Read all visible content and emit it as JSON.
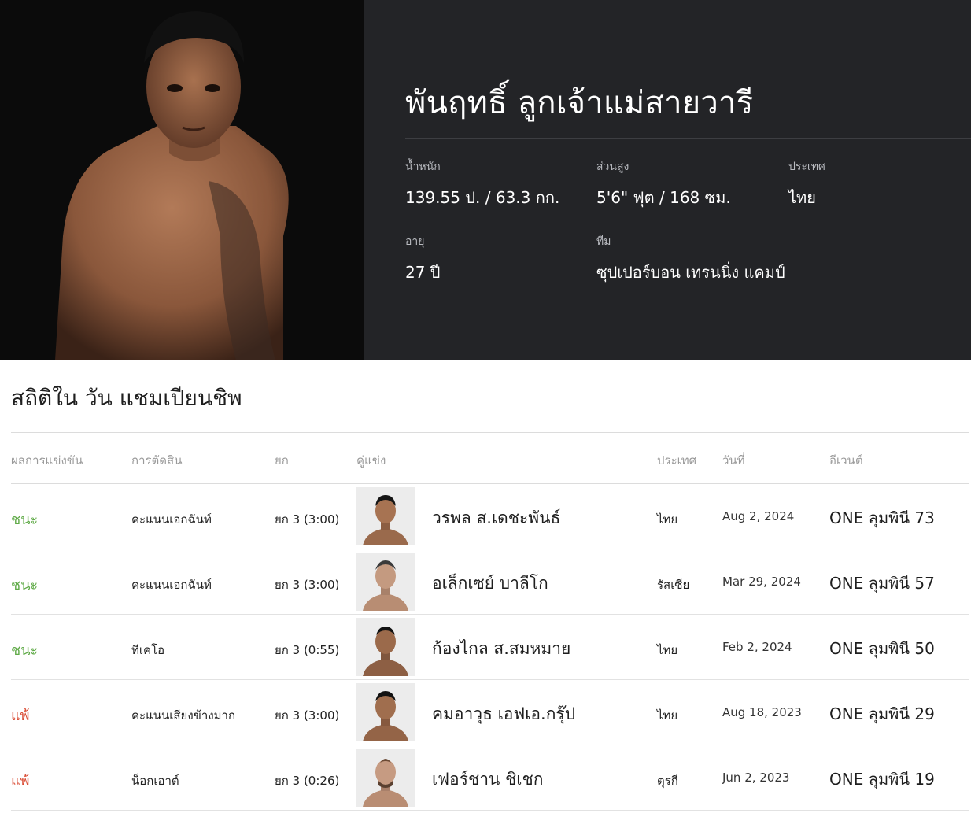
{
  "fighter": {
    "name": "พันฤทธิ์ ลูกเจ้าแม่สายวารี",
    "stats": {
      "weight_label": "น้ำหนัก",
      "weight_value": "139.55 ป. / 63.3 กก.",
      "height_label": "ส่วนสูง",
      "height_value": "5'6\" ฟุต / 168 ซม.",
      "country_label": "ประเทศ",
      "country_value": "ไทย",
      "age_label": "อายุ",
      "age_value": "27 ปี",
      "team_label": "ทีม",
      "team_value": "ซุปเปอร์บอน เทรนนิ่ง แคมป์"
    }
  },
  "record": {
    "title": "สถิติใน วัน แชมเปียนชิพ",
    "headers": {
      "result": "ผลการแข่งขัน",
      "method": "การตัดสิน",
      "round": "ยก",
      "opponent": "คู่แข่ง",
      "country": "ประเทศ",
      "date": "วันที่",
      "event": "อีเวนต์"
    },
    "rows": [
      {
        "result": "ชนะ",
        "method": "คะแนนเอกฉันท์",
        "round": "ยก 3 (3:00)",
        "opponent": "วรพล ส.เดชะพันธ์",
        "country": "ไทย",
        "date": "Aug 2, 2024",
        "event": "ONE ลุมพินี 73"
      },
      {
        "result": "ชนะ",
        "method": "คะแนนเอกฉันท์",
        "round": "ยก 3 (3:00)",
        "opponent": "อเล็กเซย์ บาลีโก",
        "country": "รัสเซีย",
        "date": "Mar 29, 2024",
        "event": "ONE ลุมพินี 57"
      },
      {
        "result": "ชนะ",
        "method": "ทีเคโอ",
        "round": "ยก 3 (0:55)",
        "opponent": "ก้องไกล ส.สมหมาย",
        "country": "ไทย",
        "date": "Feb 2, 2024",
        "event": "ONE ลุมพินี 50"
      },
      {
        "result": "แพ้",
        "method": "คะแนนเสียงข้างมาก",
        "round": "ยก 3 (3:00)",
        "opponent": "คมอาวุธ เอฟเอ.กรุ๊ป",
        "country": "ไทย",
        "date": "Aug 18, 2023",
        "event": "ONE ลุมพินี 29"
      },
      {
        "result": "แพ้",
        "method": "น็อกเอาต์",
        "round": "ยก 3 (0:26)",
        "opponent": "เฟอร์ชาน ชิเชก",
        "country": "ตุรกี",
        "date": "Jun 2, 2023",
        "event": "ONE ลุมพินี 19"
      }
    ]
  },
  "colors": {
    "win": "#5faa47",
    "loss": "#d9472f",
    "hero_bg": "#232427"
  }
}
